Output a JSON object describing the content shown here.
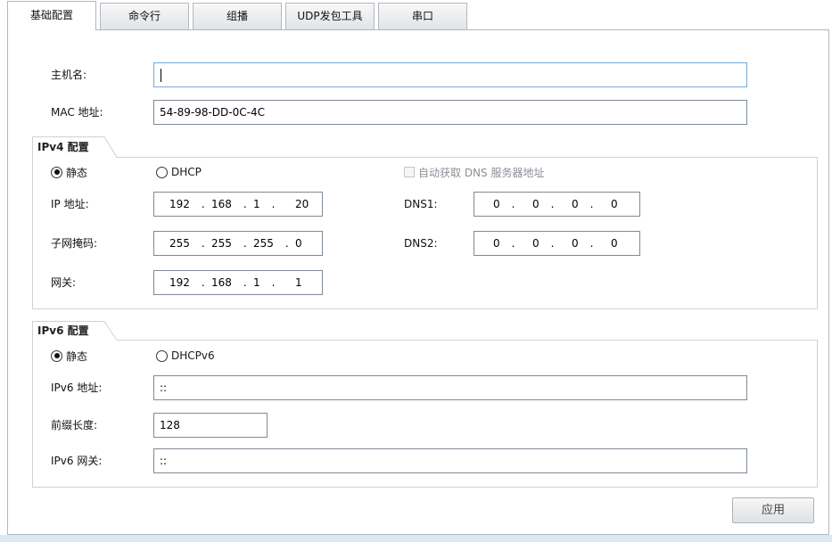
{
  "theme": {
    "focus_border": "#72a9dc",
    "window_background": "#dde7f2"
  },
  "tabs": [
    {
      "label": "基础配置",
      "active": true
    },
    {
      "label": "命令行",
      "active": false
    },
    {
      "label": "组播",
      "active": false
    },
    {
      "label": "UDP发包工具",
      "active": false
    },
    {
      "label": "串口",
      "active": false
    }
  ],
  "basic": {
    "hostname": {
      "label": "主机名:",
      "value": "",
      "focused": true
    },
    "mac": {
      "label": "MAC 地址:",
      "value": "54-89-98-DD-0C-4C"
    }
  },
  "ipv4": {
    "title": "IPv4 配置",
    "static": {
      "label": "静态",
      "checked": true
    },
    "dhcp": {
      "label": "DHCP",
      "checked": false
    },
    "auto_dns": {
      "label": "自动获取 DNS 服务器地址",
      "checked": false,
      "disabled": true
    },
    "octet_separator": ".",
    "ip": {
      "label": "IP 地址:",
      "octets": [
        "192",
        "168",
        "1",
        "20"
      ]
    },
    "mask": {
      "label": "子网掩码:",
      "octets": [
        "255",
        "255",
        "255",
        "0"
      ]
    },
    "gateway": {
      "label": "网关:",
      "octets": [
        "192",
        "168",
        "1",
        "1"
      ]
    },
    "dns1": {
      "label": "DNS1:",
      "octets": [
        "0",
        "0",
        "0",
        "0"
      ]
    },
    "dns2": {
      "label": "DNS2:",
      "octets": [
        "0",
        "0",
        "0",
        "0"
      ]
    }
  },
  "ipv6": {
    "title": "IPv6 配置",
    "static": {
      "label": "静态",
      "checked": true
    },
    "dhcpv6": {
      "label": "DHCPv6",
      "checked": false
    },
    "address": {
      "label": "IPv6 地址:",
      "value": "::"
    },
    "prefix_length": {
      "label": "前缀长度:",
      "value": "128"
    },
    "gateway": {
      "label": "IPv6 网关:",
      "value": "::"
    }
  },
  "actions": {
    "apply_label": "应用"
  }
}
